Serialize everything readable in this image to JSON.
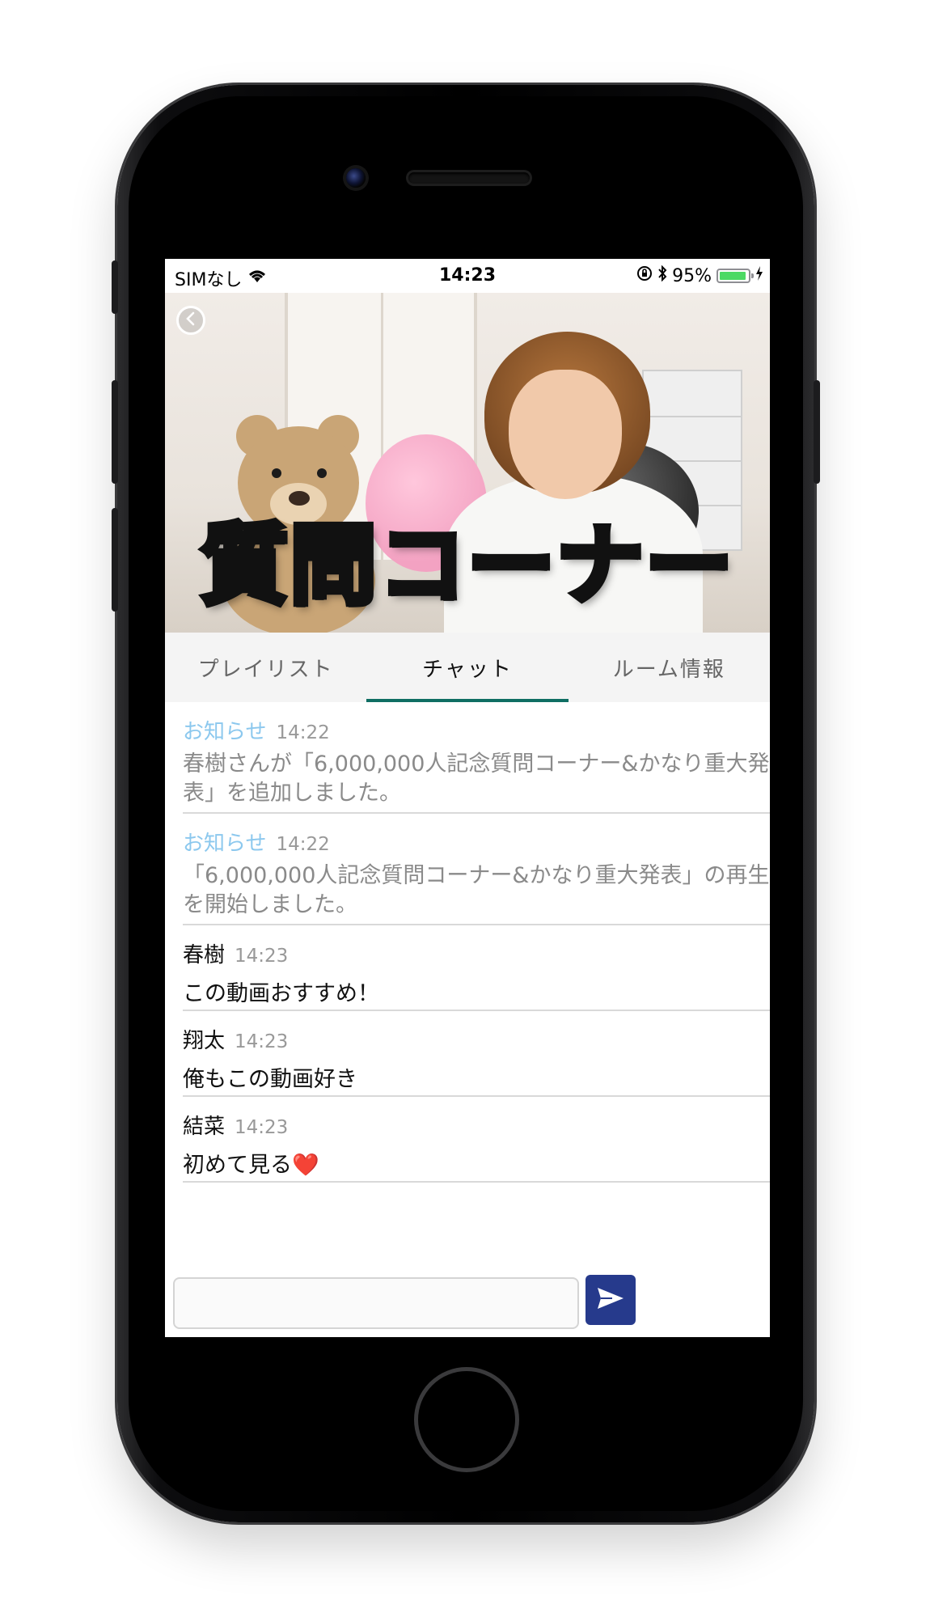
{
  "status_bar": {
    "carrier": "SIMなし",
    "time": "14:23",
    "battery_percent": "95%",
    "battery_level": 0.95
  },
  "video": {
    "title_overlay": "質問コーナー",
    "back_icon": "chevron-left-icon"
  },
  "tabs": [
    {
      "label": "プレイリスト",
      "active": false
    },
    {
      "label": "チャット",
      "active": true
    },
    {
      "label": "ルーム情報",
      "active": false
    }
  ],
  "chat": {
    "messages": [
      {
        "sender": "お知らせ",
        "time": "14:22",
        "text": "春樹さんが「6,000,000人記念質問コーナー&かなり重大発表」を追加しました。",
        "system": true
      },
      {
        "sender": "お知らせ",
        "time": "14:22",
        "text": "「6,000,000人記念質問コーナー&かなり重大発表」の再生を開始しました。",
        "system": true
      },
      {
        "sender": "春樹",
        "time": "14:23",
        "text": "この動画おすすめ！",
        "system": false
      },
      {
        "sender": "翔太",
        "time": "14:23",
        "text": "俺もこの動画好き",
        "system": false
      },
      {
        "sender": "結菜",
        "time": "14:23",
        "text": "初めて見る❤️",
        "system": false
      }
    ]
  },
  "input": {
    "value": "",
    "placeholder": ""
  },
  "colors": {
    "accent": "#0f6e63",
    "send_button": "#263a8c",
    "system_sender": "#8cc8ee"
  }
}
